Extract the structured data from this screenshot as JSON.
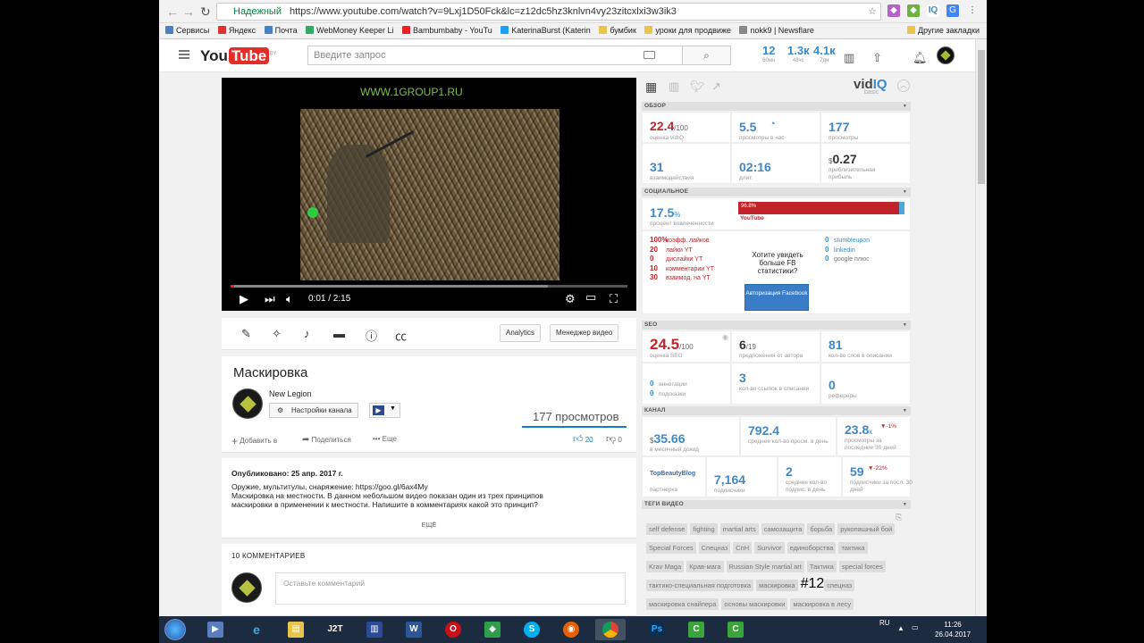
{
  "browser": {
    "secure_label": "Надежный",
    "url": "https://www.youtube.com/watch?v=9Lxj1D50Fck&lc=z12dc5hz3knlvn4vy23zitcxlxi3w3ik3",
    "bookmarks": [
      "Сервисы",
      "Яндекс",
      "Почта",
      "WebMoney Keeper Li",
      "Bambumbaby - YouTu",
      "KaterinaBurst (Katerin",
      "бумбик",
      "уроки для продвиже",
      "nokk9 | Newsflare"
    ],
    "other_bookmarks": "Другие закладки"
  },
  "header": {
    "logo_text": "You",
    "logo_tube": "Tube",
    "region": "BY",
    "search_placeholder": "Введите запрос",
    "stats": [
      {
        "value": "12",
        "label": "60мн"
      },
      {
        "value": "1.3к",
        "label": "48чс"
      },
      {
        "value": "4.1к",
        "label": "7дн"
      }
    ]
  },
  "player": {
    "watermark": "WWW.1GROUP1.RU",
    "time": "0:01 / 2:15",
    "progress_fraction": 0.008
  },
  "toolbar": {
    "analytics": "Analytics",
    "manager": "Менеджер видео"
  },
  "video": {
    "title": "Маскировка",
    "channel": "New Legion",
    "channel_settings": "Настройки канала",
    "views": "177 просмотров",
    "add_to": "Добавить в",
    "share": "Поделиться",
    "more": "Еще",
    "likes": "20",
    "dislikes": "0"
  },
  "description": {
    "published": "Опубликовано: 25 апр. 2017 г.",
    "line1": "Оружие, мультитулы, снаряжение: https://goo.gl/6ax4My",
    "line2": "Маскировка на местности. В данном небольшом видео показан один из трех принципов",
    "line3": "маскировки в применении к местности. Напишите в комментариях какой это принцип?",
    "more": "ЕЩЁ"
  },
  "comments": {
    "header": "10 КОММЕНТАРИЕВ",
    "placeholder": "Оставьте комментарий"
  },
  "vidiq": {
    "logo": "vid",
    "logo_iq": "IQ",
    "tier": "basic",
    "overview_header": "ОБЗОР",
    "score": "22.4",
    "score_max": "/100",
    "score_label": "оценка vidIQ",
    "vph": "5.5",
    "vph_label": "просмотры в час",
    "views": "177",
    "views_label": "просмотры",
    "interactions": "31",
    "interactions_label": "взаимодействия",
    "length": "02:16",
    "length_label": "длит.",
    "revenue": "0.27",
    "revenue_label": "приблизительная прибыль",
    "social_header": "СОЦИАЛЬНОЕ",
    "engagement": "17.5",
    "engagement_label": "процент вовлеченности",
    "yt_share": "96.8%",
    "yt_label": "YouTube",
    "social_rows": [
      {
        "v": "100%",
        "t": "коэфф. лайков"
      },
      {
        "v": "20",
        "t": "лайки YT"
      },
      {
        "v": "0",
        "t": "дислайки YT"
      },
      {
        "v": "10",
        "t": "комментарии YT"
      },
      {
        "v": "30",
        "t": "взаимод. на YT"
      }
    ],
    "fb_text": "Хотите увидеть больше FB статистики?",
    "fb_button": "Авторизация Facebook",
    "other_rows": [
      {
        "v": "0",
        "t": "stumbleupon"
      },
      {
        "v": "0",
        "t": "linkedin"
      },
      {
        "v": "0",
        "t": "google плюс"
      }
    ],
    "seo_header": "SEO",
    "seo_score": "24.5",
    "seo_max": "/100",
    "seo_label": "оценка SEO",
    "suggest": "6",
    "suggest_max": "/19",
    "suggest_label": "предложения от автора",
    "desc_words": "81",
    "desc_words_label": "кол-во слов в описании",
    "annot": "0",
    "annot_label": "аннотации",
    "subs_hint": "0",
    "subs_hint_label": "подсказки",
    "links": "3",
    "links_label": "кол-во ссылок в описании",
    "referrers": "0",
    "referrers_label": "рефереры",
    "channel_header": "КАНАЛ",
    "monthly": "35.66",
    "monthly_label": "в месячный доход",
    "avg_views": "792.4",
    "avg_views_label": "среднее кол-во просм. в день",
    "views30": "23.8",
    "views30_unit": "к",
    "views30_delta": "▼-1%",
    "views30_label": "просмотры за последние 30 дней",
    "partner": "TopBeautyBlog",
    "partner_label": "партнерка",
    "subs": "7,164",
    "subs_label": "подписчики",
    "avg_subs": "2",
    "avg_subs_label": "среднее кол-во подпис. в день",
    "subs30": "59",
    "subs30_delta": "▼-22%",
    "subs30_label": "подписчики за посл. 30 дней",
    "tags_header": "ТЕГИ ВИДЕО",
    "tags": [
      "self defense",
      "fighting",
      "martial arts",
      "самозащита",
      "борьба",
      "рукопашный бой",
      "Special Forces",
      "Спецназ",
      "СпН",
      "Survivor",
      "единоборства",
      "тактика",
      "Krav Maga",
      "Крав-мага",
      "Russian Style martial art",
      "Тактика",
      "special forces",
      "тактико-специальная подготовка",
      "маскировка",
      "спецназ",
      "маскировка снайпера",
      "основы маскировки",
      "маскировка в лесу",
      "маскировка на местности",
      "хорошая маскировка"
    ],
    "tag_badge": "#12"
  },
  "taskbar": {
    "lang": "RU",
    "time": "11:26",
    "date": "26.04.2017"
  }
}
